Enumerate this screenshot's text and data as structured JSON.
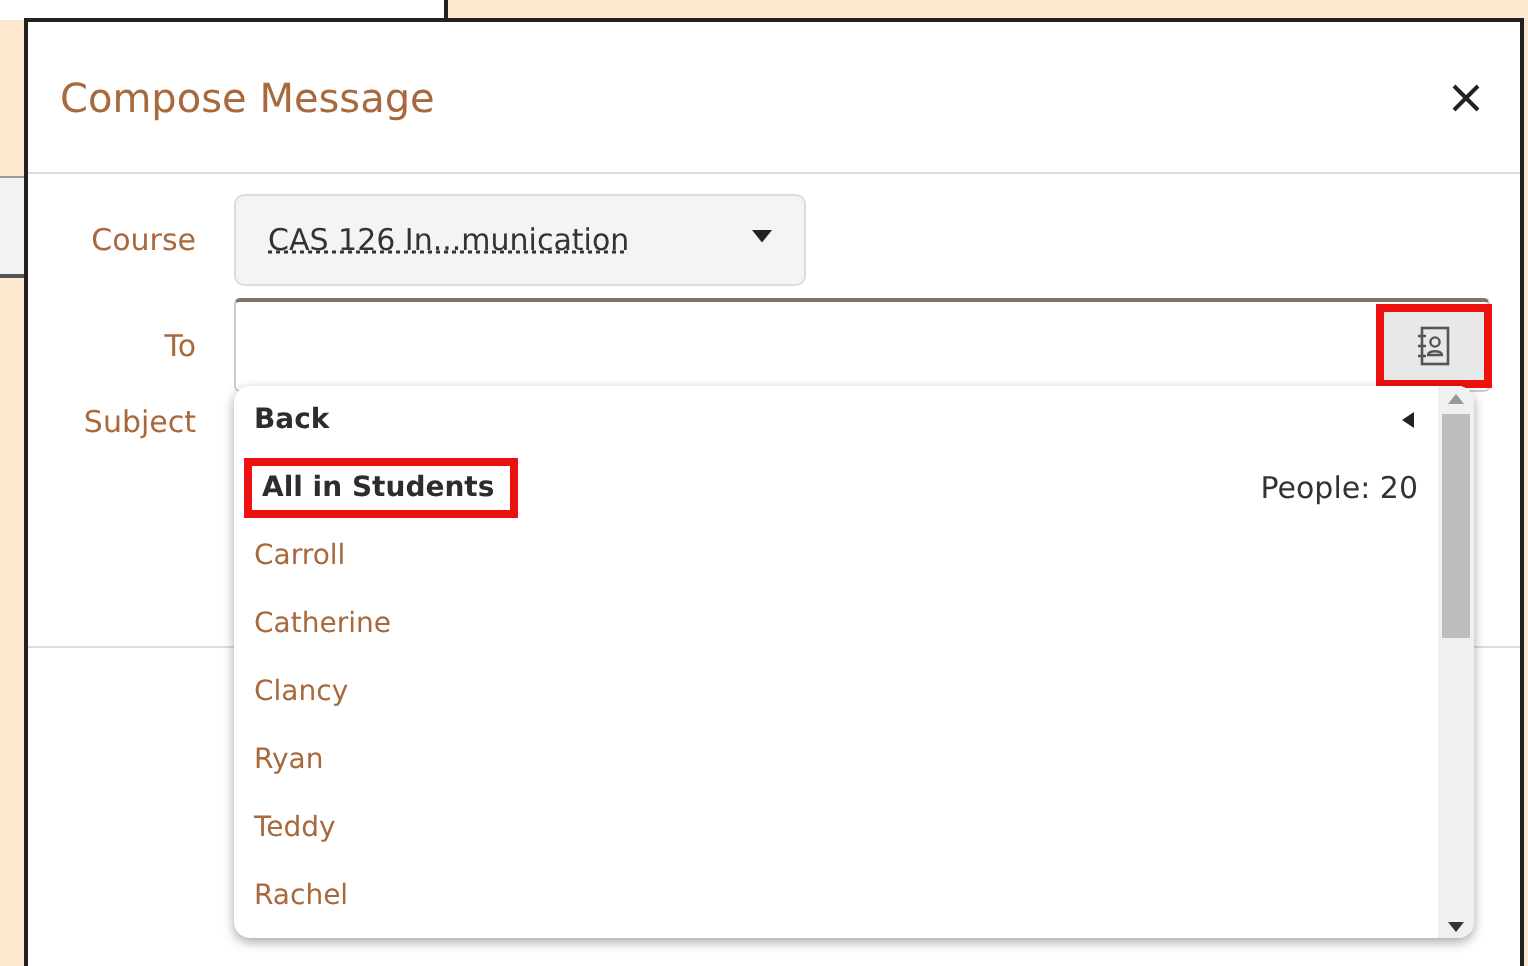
{
  "dialog": {
    "title": "Compose Message",
    "course": {
      "label": "Course",
      "value": "CAS 126 In...munication"
    },
    "to": {
      "label": "To",
      "address_book_highlighted": true
    },
    "subject": {
      "label": "Subject"
    },
    "recipients": [
      {
        "kind": "back",
        "label": "Back",
        "highlighted": false
      },
      {
        "kind": "group",
        "label": "All in Students",
        "count": "People: 20",
        "highlighted": true
      },
      {
        "kind": "person",
        "label": "Carroll",
        "highlighted": false
      },
      {
        "kind": "person",
        "label": "Catherine",
        "highlighted": false
      },
      {
        "kind": "person",
        "label": "Clancy",
        "highlighted": false
      },
      {
        "kind": "person",
        "label": "Ryan",
        "highlighted": false
      },
      {
        "kind": "person",
        "label": "Teddy",
        "highlighted": false
      },
      {
        "kind": "person",
        "label": "Rachel",
        "highlighted": false
      }
    ]
  }
}
